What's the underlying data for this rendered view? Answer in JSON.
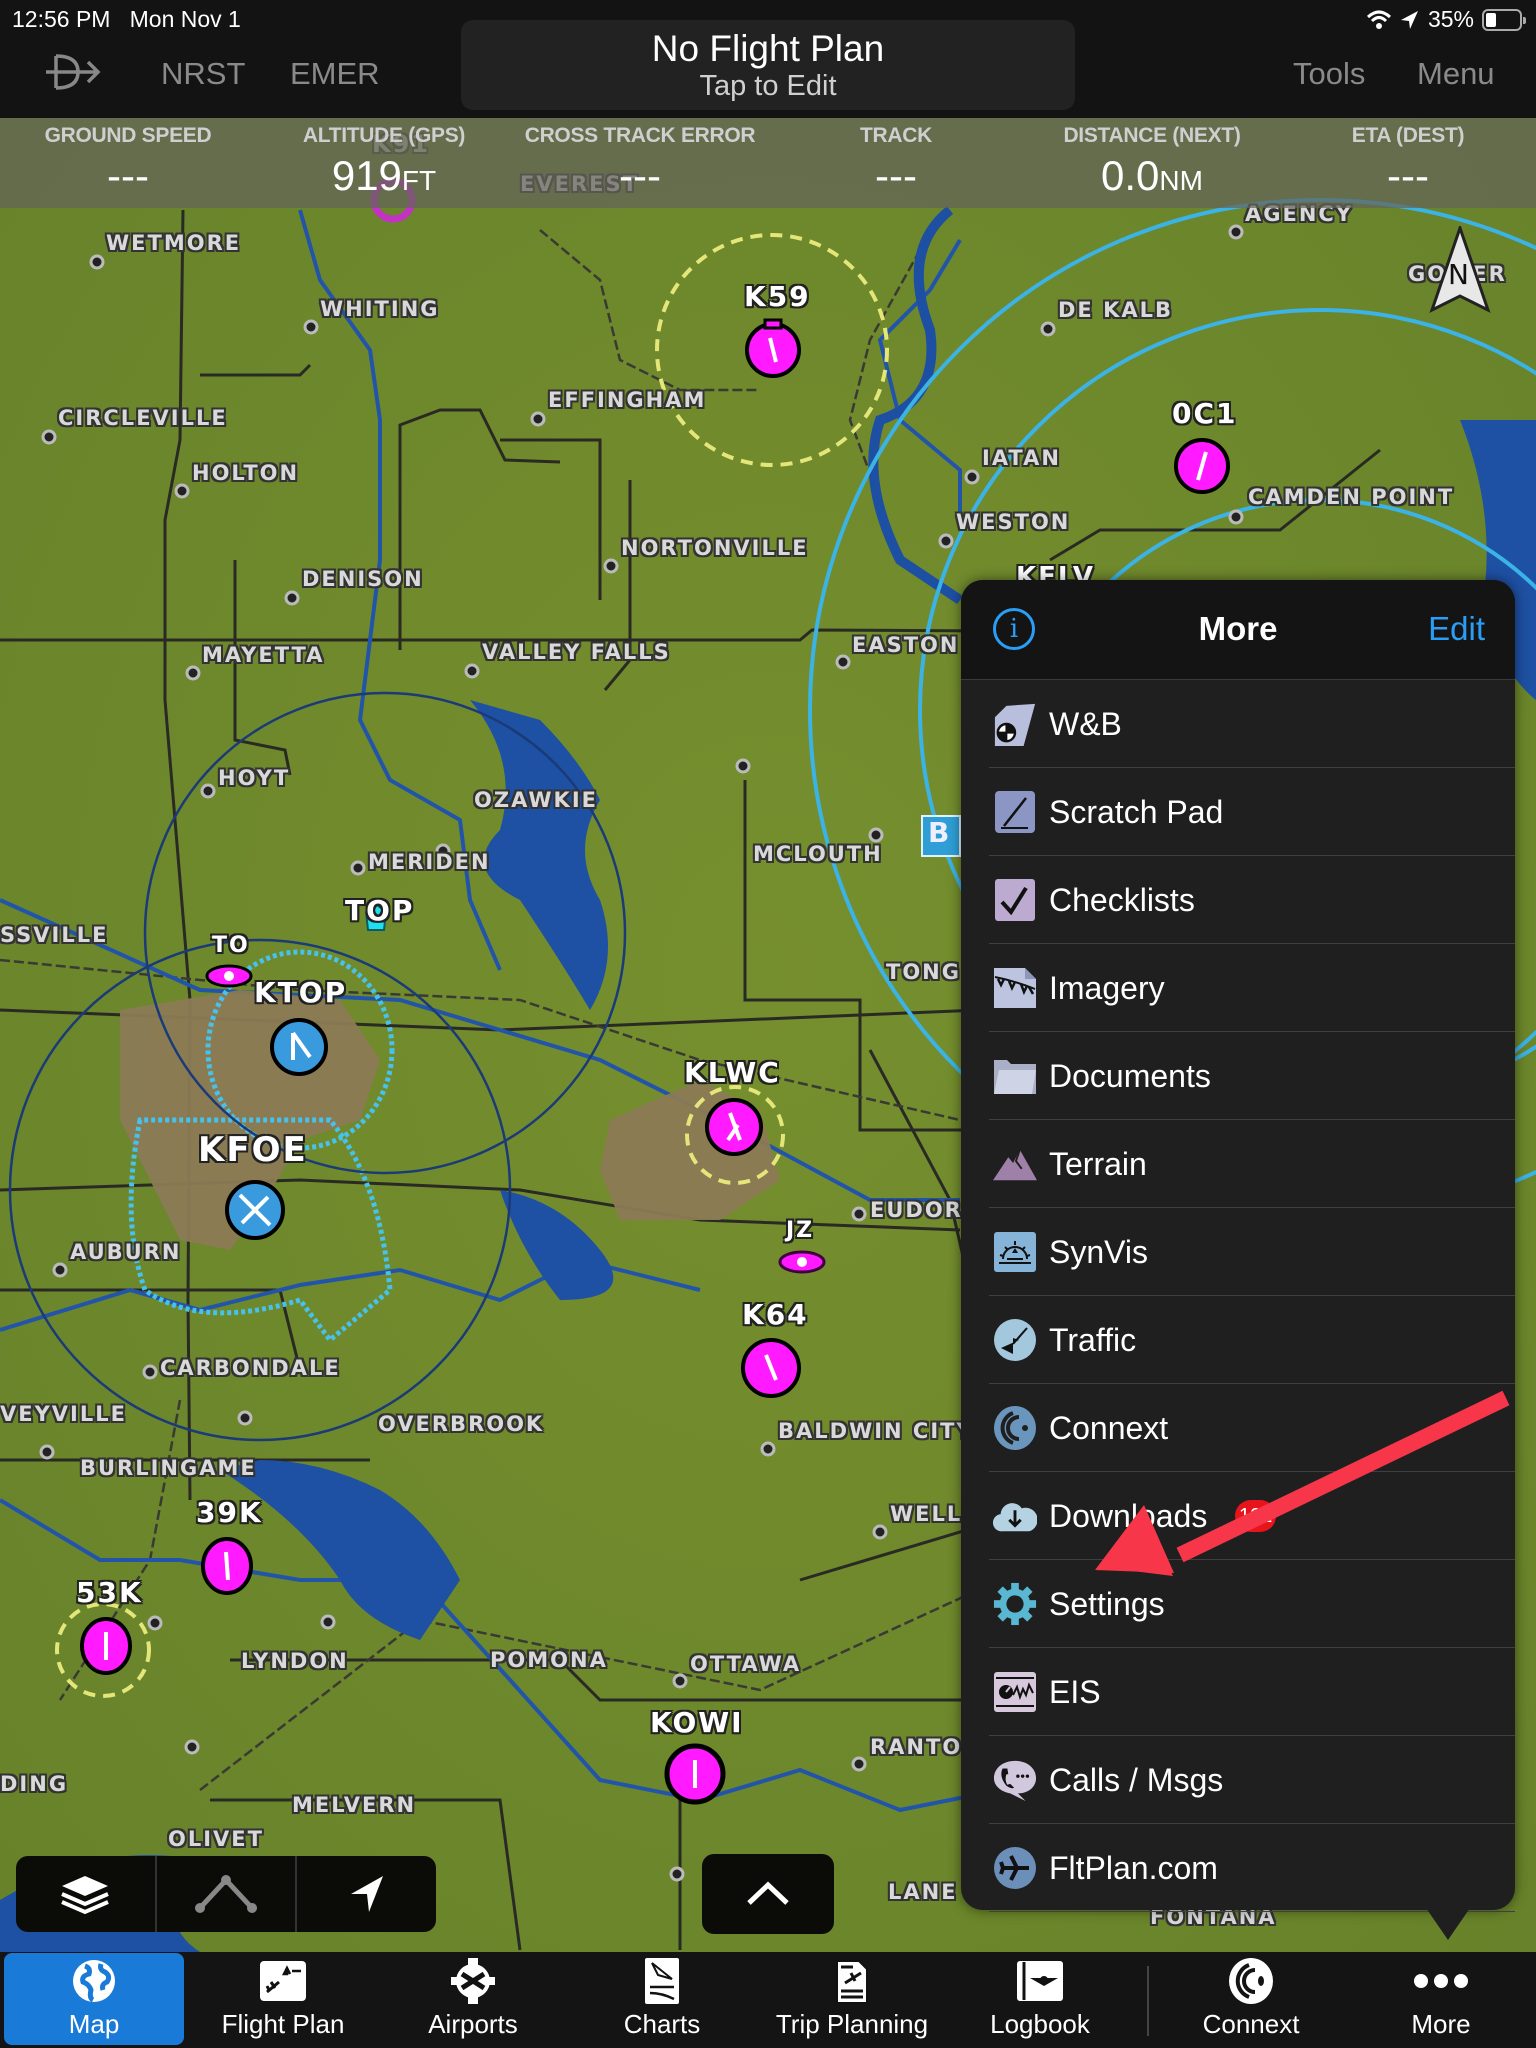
{
  "status_bar": {
    "time": "12:56 PM",
    "date": "Mon Nov 1",
    "battery_percent": "35%",
    "battery_level": 0.35,
    "icons": [
      "wifi-icon",
      "location-arrow-icon",
      "battery-icon"
    ]
  },
  "top_bar": {
    "direct_to_icon": "direct-to-icon",
    "nrst_label": "NRST",
    "emer_label": "EMER",
    "flight_plan_title": "No Flight Plan",
    "flight_plan_subtitle": "Tap to Edit",
    "tools_label": "Tools",
    "menu_label": "Menu"
  },
  "data_strip": [
    {
      "label": "GROUND SPEED",
      "value": "---",
      "unit": ""
    },
    {
      "label": "ALTITUDE (GPS)",
      "value": "919",
      "unit": "FT"
    },
    {
      "label": "CROSS TRACK ERROR",
      "value": "---",
      "unit": ""
    },
    {
      "label": "TRACK",
      "value": "---",
      "unit": ""
    },
    {
      "label": "DISTANCE (NEXT)",
      "value": "0.0",
      "unit": "NM"
    },
    {
      "label": "ETA (DEST)",
      "value": "---",
      "unit": ""
    }
  ],
  "map": {
    "compass_label": "N",
    "towns": [
      {
        "name": "WETMORE"
      },
      {
        "name": "WHITING"
      },
      {
        "name": "CIRCLEVILLE"
      },
      {
        "name": "HOLTON"
      },
      {
        "name": "EFFINGHAM"
      },
      {
        "name": "DENISON"
      },
      {
        "name": "NORTONVILLE"
      },
      {
        "name": "MAYETTA"
      },
      {
        "name": "VALLEY FALLS"
      },
      {
        "name": "AGENCY"
      },
      {
        "name": "DE KALB"
      },
      {
        "name": "IATAN"
      },
      {
        "name": "CAMDEN POINT"
      },
      {
        "name": "WESTON"
      },
      {
        "name": "EASTON"
      },
      {
        "name": "HOYT"
      },
      {
        "name": "OZAWKIE"
      },
      {
        "name": "MERIDEN"
      },
      {
        "name": "MCLOUTH"
      },
      {
        "name": "TONG"
      },
      {
        "name": "AUBURN"
      },
      {
        "name": "CARBONDALE"
      },
      {
        "name": "OVERBROOK"
      },
      {
        "name": "BURLINGAME"
      },
      {
        "name": "BALDWIN CITY"
      },
      {
        "name": "EUDOR"
      },
      {
        "name": "WELL"
      },
      {
        "name": "LYNDON"
      },
      {
        "name": "POMONA"
      },
      {
        "name": "OTTAWA"
      },
      {
        "name": "RANTO"
      },
      {
        "name": "MELVERN"
      },
      {
        "name": "OLIVET"
      },
      {
        "name": "LANE"
      },
      {
        "name": "FONTANA"
      },
      {
        "name": "SSVILLE"
      },
      {
        "name": "VEYVILLE"
      },
      {
        "name": "DING"
      },
      {
        "name": "EVEREST"
      },
      {
        "name": "GOWER"
      }
    ],
    "airports": [
      {
        "id": "K59",
        "type": "private"
      },
      {
        "id": "0C1",
        "type": "private"
      },
      {
        "id": "KTOP",
        "type": "towered"
      },
      {
        "id": "KFOE",
        "type": "towered"
      },
      {
        "id": "KLWC",
        "type": "public"
      },
      {
        "id": "K64",
        "type": "public"
      },
      {
        "id": "39K",
        "type": "public"
      },
      {
        "id": "53K",
        "type": "public"
      },
      {
        "id": "KOWI",
        "type": "public"
      },
      {
        "id": "K91",
        "type": "public"
      },
      {
        "id": "KELV",
        "type": "public"
      }
    ],
    "navaids": [
      {
        "id": "TOP",
        "type": "vor"
      },
      {
        "id": "TO",
        "type": "ndb"
      },
      {
        "id": "JZ",
        "type": "ndb"
      }
    ],
    "airspace_label": "B",
    "controls": {
      "layers_icon": "layers-icon",
      "route_icon": "route-icon",
      "track_up_icon": "track-up-icon",
      "expand_icon": "chevron-up-icon"
    }
  },
  "more_menu": {
    "title": "More",
    "edit_label": "Edit",
    "info_icon": "i",
    "items": [
      {
        "label": "W&B",
        "icon": "weight-balance-icon"
      },
      {
        "label": "Scratch Pad",
        "icon": "scratch-pad-icon"
      },
      {
        "label": "Checklists",
        "icon": "checklist-icon"
      },
      {
        "label": "Imagery",
        "icon": "imagery-icon"
      },
      {
        "label": "Documents",
        "icon": "folder-icon"
      },
      {
        "label": "Terrain",
        "icon": "mountain-icon"
      },
      {
        "label": "SynVis",
        "icon": "synvis-icon"
      },
      {
        "label": "Traffic",
        "icon": "traffic-icon"
      },
      {
        "label": "Connext",
        "icon": "connext-icon"
      },
      {
        "label": "Downloads",
        "icon": "cloud-download-icon",
        "badge": "122"
      },
      {
        "label": "Settings",
        "icon": "gear-icon"
      },
      {
        "label": "EIS",
        "icon": "engine-gauge-icon"
      },
      {
        "label": "Calls / Msgs",
        "icon": "phone-message-icon"
      },
      {
        "label": "FltPlan.com",
        "icon": "airplane-icon"
      }
    ]
  },
  "annotation": {
    "arrow_color": "#f7364a",
    "points_to": "Settings"
  },
  "tab_bar": {
    "tabs": [
      {
        "label": "Map",
        "icon": "globe-icon",
        "active": true
      },
      {
        "label": "Flight Plan",
        "icon": "flight-plan-icon",
        "active": false
      },
      {
        "label": "Airports",
        "icon": "airport-icon",
        "active": false
      },
      {
        "label": "Charts",
        "icon": "charts-icon",
        "active": false
      },
      {
        "label": "Trip Planning",
        "icon": "trip-planning-icon",
        "active": false
      },
      {
        "label": "Logbook",
        "icon": "logbook-icon",
        "active": false
      },
      {
        "label": "Connext",
        "icon": "connext-icon",
        "active": false
      },
      {
        "label": "More",
        "icon": "more-dots-icon",
        "active": false
      }
    ]
  },
  "colors": {
    "accent_blue": "#2a9df4",
    "active_tab": "#1a7ad8",
    "map_green": "#6f8a2c",
    "airport_magenta": "#ff1aff",
    "airport_towered_blue": "#3a9ade",
    "badge_red": "#e8141c"
  }
}
